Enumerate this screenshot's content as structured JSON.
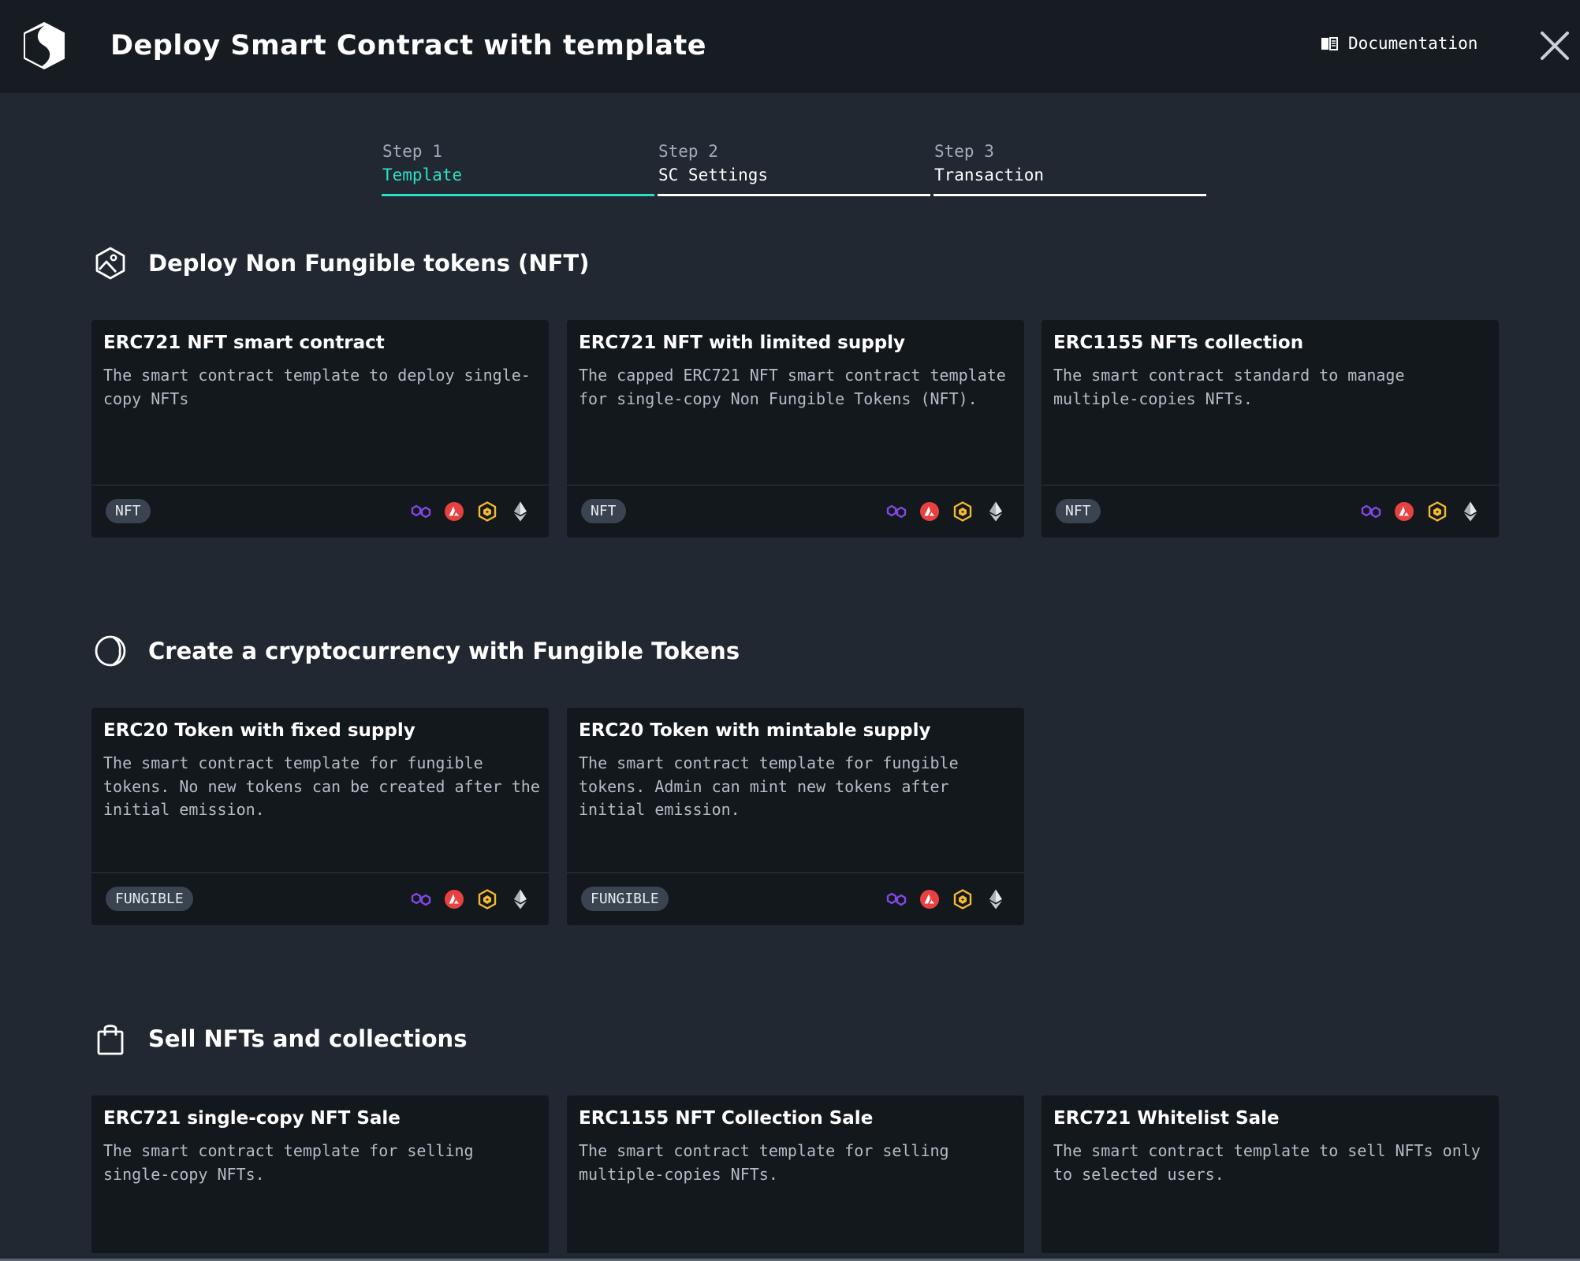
{
  "header": {
    "title": "Deploy Smart Contract with template",
    "documentation_label": "Documentation"
  },
  "steps": [
    {
      "number": "Step 1",
      "label": "Template",
      "active": true
    },
    {
      "number": "Step 2",
      "label": "SC Settings",
      "active": false
    },
    {
      "number": "Step 3",
      "label": "Transaction",
      "active": false
    }
  ],
  "sections": [
    {
      "title": "Deploy Non Fungible tokens (NFT)",
      "icon": "nft-image-icon",
      "cards": [
        {
          "title": "ERC721 NFT smart contract",
          "description": "The smart contract template to deploy single-copy NFTs",
          "badge": "NFT"
        },
        {
          "title": "ERC721 NFT with limited supply",
          "description": "The capped ERC721 NFT smart contract template for single-copy Non Fungible Tokens (NFT).",
          "badge": "NFT"
        },
        {
          "title": "ERC1155 NFTs collection",
          "description": "The smart contract standard to manage multiple-copies NFTs.",
          "badge": "NFT"
        }
      ]
    },
    {
      "title": "Create a cryptocurrency with Fungible Tokens",
      "icon": "coin-icon",
      "cards": [
        {
          "title": "ERC20 Token with fixed supply",
          "description": "The smart contract template for fungible tokens. No new tokens can be created after the initial emission.",
          "badge": "FUNGIBLE"
        },
        {
          "title": "ERC20 Token with mintable supply",
          "description": "The smart contract template for fungible tokens. Admin can mint new tokens after initial emission.",
          "badge": "FUNGIBLE"
        }
      ]
    },
    {
      "title": "Sell NFTs and collections",
      "icon": "shopping-bag-icon",
      "cards": [
        {
          "title": "ERC721 single-copy NFT Sale",
          "description": "The smart contract template for selling single-copy NFTs."
        },
        {
          "title": "ERC1155 NFT Collection Sale",
          "description": "The smart contract template for selling multiple-copies NFTs."
        },
        {
          "title": "ERC721 Whitelist Sale",
          "description": "The smart contract template to sell NFTs only to selected users."
        }
      ]
    }
  ],
  "chain_icons": [
    "polygon-icon",
    "avalanche-icon",
    "bnb-icon",
    "ethereum-icon"
  ],
  "colors": {
    "accent": "#2de0c5",
    "polygon": "#8247e5",
    "avalanche": "#e84142",
    "bnb": "#f3ba2f",
    "ethereum": "#e6e9ee"
  }
}
